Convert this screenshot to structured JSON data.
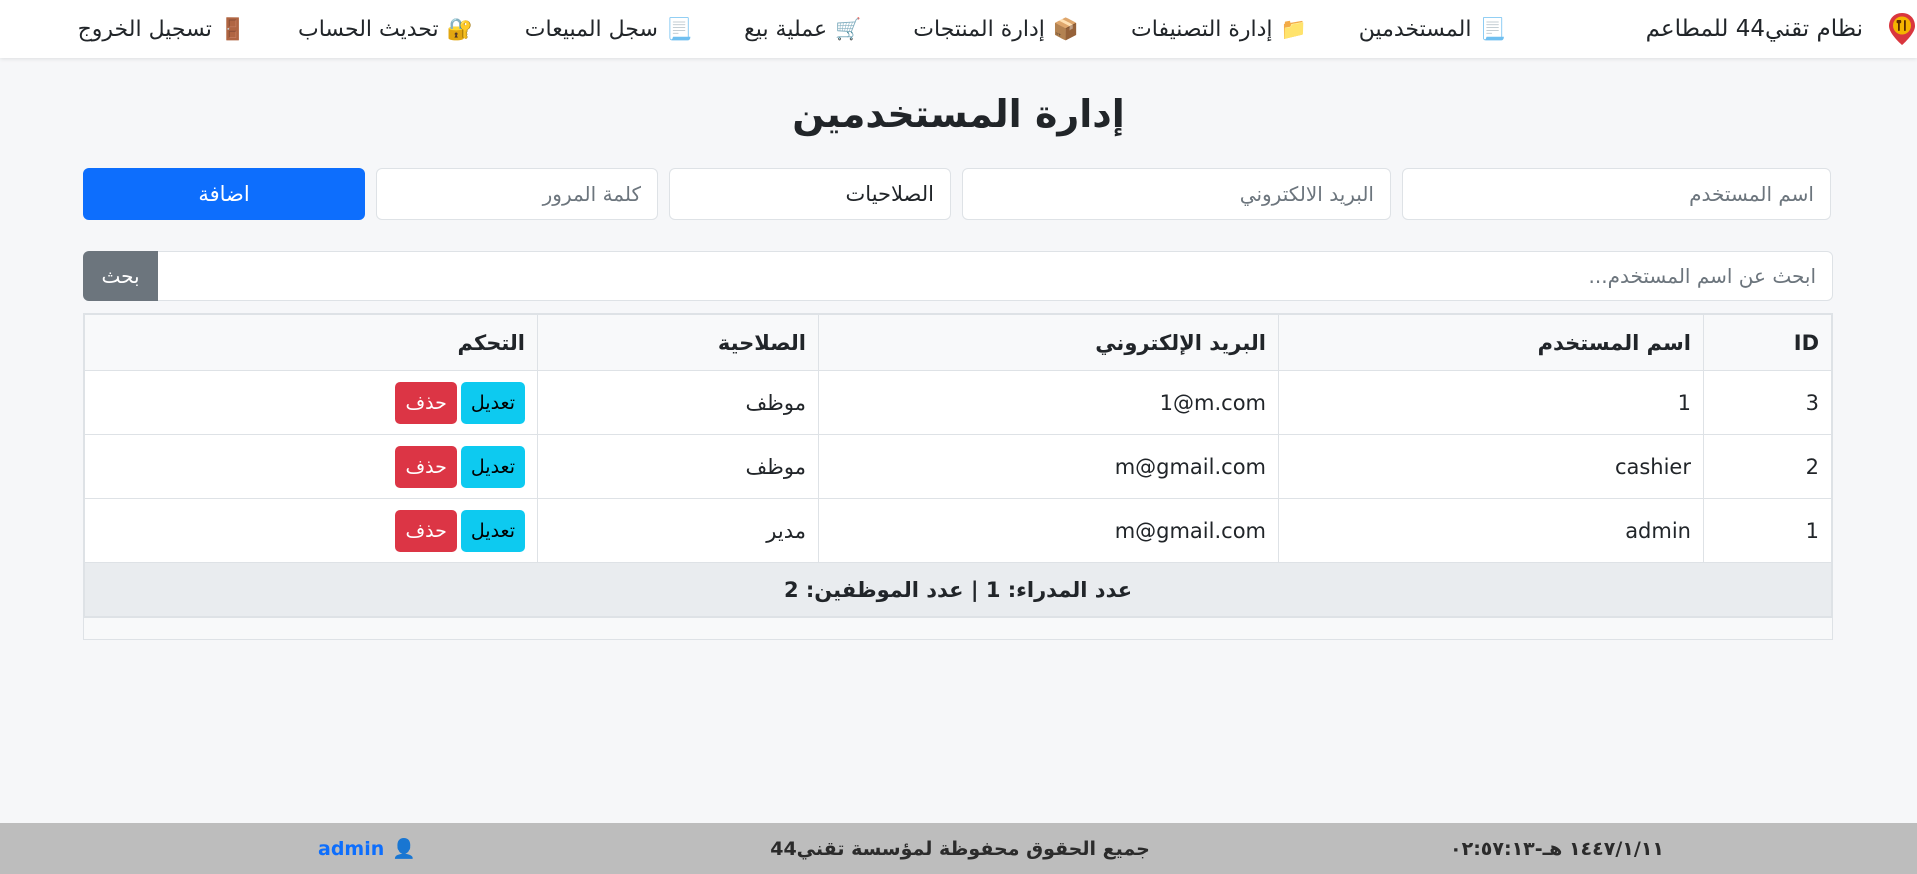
{
  "navbar": {
    "brand": "نظام تقني44 للمطاعم",
    "items": [
      {
        "label": "المستخدمين",
        "icon": "📃",
        "icon_name": "document-icon"
      },
      {
        "label": "إدارة التصنيفات",
        "icon": "📁",
        "icon_name": "folder-icon"
      },
      {
        "label": "إدارة المنتجات",
        "icon": "📦",
        "icon_name": "package-icon"
      },
      {
        "label": "عملية بيع",
        "icon": "🛒",
        "icon_name": "cart-icon"
      },
      {
        "label": "سجل المبيعات",
        "icon": "📃",
        "icon_name": "document-icon"
      },
      {
        "label": "تحديث الحساب",
        "icon": "🔐",
        "icon_name": "lock-icon"
      },
      {
        "label": "تسجيل الخروج",
        "icon": "🚪",
        "icon_name": "door-icon"
      }
    ]
  },
  "page": {
    "title": "إدارة المستخدمين"
  },
  "form": {
    "username_placeholder": "اسم المستخدم",
    "email_placeholder": "البريد الالكتروني",
    "role_selected": "الصلاحيات",
    "password_placeholder": "كلمة المرور",
    "add_label": "اضافة"
  },
  "search": {
    "placeholder": "ابحث عن اسم المستخدم...",
    "button_label": "بحث"
  },
  "table": {
    "headers": {
      "id": "ID",
      "username": "اسم المستخدم",
      "email": "البريد الإلكتروني",
      "role": "الصلاحية",
      "actions": "التحكم"
    },
    "rows": [
      {
        "id": "3",
        "username": "1",
        "email": "1@m.com",
        "role": "موظف",
        "edit": "تعديل",
        "delete": "حذف"
      },
      {
        "id": "2",
        "username": "cashier",
        "email": "m@gmail.com",
        "role": "موظف",
        "edit": "تعديل",
        "delete": "حذف"
      },
      {
        "id": "1",
        "username": "admin",
        "email": "m@gmail.com",
        "role": "مدير",
        "edit": "تعديل",
        "delete": "حذف"
      }
    ],
    "summary": "عدد المدراء: 1 | عدد الموظفين: 2"
  },
  "footer": {
    "user": "admin",
    "user_icon": "👤",
    "copyright": "جميع الحقوق محفوظة لمؤسسة تقني44",
    "datetime": "١٤٤٧/١/١١ هـ-٠٢:٥٧:١٣"
  },
  "colors": {
    "primary": "#0d6efd",
    "info": "#0dcaf0",
    "danger": "#dc3545",
    "secondary": "#6c757d",
    "footer_bg": "#bdbdbd"
  }
}
